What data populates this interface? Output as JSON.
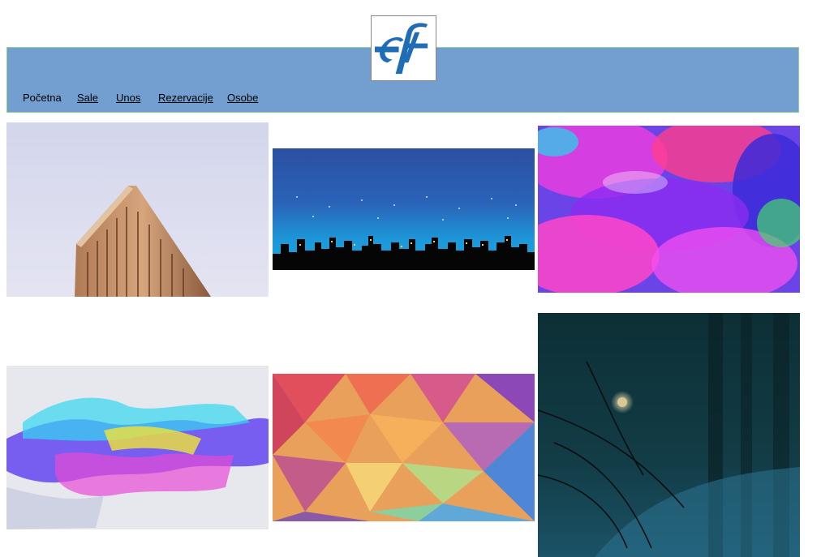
{
  "nav": {
    "home": "Početna",
    "sale": "Sale",
    "unos": "Unos",
    "rezervacije": "Rezervacije",
    "osobe": "Osobe"
  },
  "colors": {
    "header_bg": "#729fcf",
    "header_border": "#8fd18f"
  },
  "gallery": [
    {
      "subject": "flatiron-building"
    },
    {
      "subject": "night-city-skyline"
    },
    {
      "subject": "watercolor-abstract"
    },
    {
      "subject": "paint-splash-abstract"
    },
    {
      "subject": "low-poly-gradient"
    },
    {
      "subject": "dark-forest-road"
    }
  ]
}
